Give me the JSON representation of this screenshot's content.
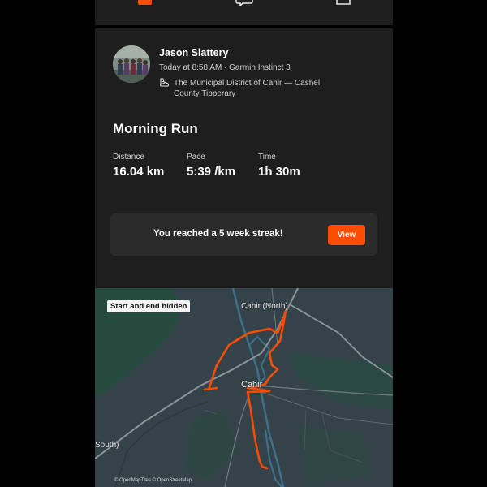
{
  "top_icons": [
    "home-icon",
    "chat-icon",
    "share-icon"
  ],
  "activity": {
    "athlete_name": "Jason Slattery",
    "meta": "Today at 8:58 AM · Garmin Instinct 3",
    "location": "The Municipal District of Cahir — Cashel, County Tipperary",
    "title": "Morning Run",
    "stats": [
      {
        "label": "Distance",
        "value": "16.04 km"
      },
      {
        "label": "Pace",
        "value": "5:39 /km"
      },
      {
        "label": "Time",
        "value": "1h 30m"
      }
    ]
  },
  "streak": {
    "text": "You reached a 5 week streak!",
    "button": "View"
  },
  "map": {
    "badge": "Start and end hidden",
    "labels": {
      "north": "Cahir (North)",
      "town": "Cahir",
      "south": "South)"
    },
    "attribution": "© OpenMapTiles © OpenStreetMap"
  },
  "colors": {
    "accent": "#fc4c02",
    "card": "#1e1e1e",
    "map_base": "#34434a",
    "map_green": "#264a3e",
    "route": "#fc4c02"
  }
}
